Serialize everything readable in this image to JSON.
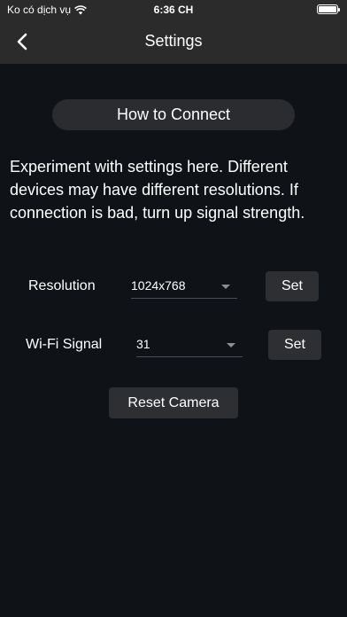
{
  "status_bar": {
    "carrier": "Ko có dịch vụ",
    "time": "6:36 CH"
  },
  "nav": {
    "title": "Settings"
  },
  "how_to_connect": "How to Connect",
  "info_text": "Experiment with settings here. Different devices may have different resolutions. If connection is bad, turn up signal strength.",
  "resolution": {
    "label": "Resolution",
    "value": "1024x768",
    "set_label": "Set"
  },
  "wifi_signal": {
    "label": "Wi-Fi Signal",
    "value": "31",
    "set_label": "Set"
  },
  "reset_camera": "Reset Camera",
  "icons": {
    "wifi": "wifi-icon",
    "battery": "battery-icon",
    "back": "chevron-left-icon",
    "dropdown": "chevron-down-icon"
  },
  "colors": {
    "background": "#0f1318",
    "bar": "#2b2b2b",
    "button": "#2d2f33"
  }
}
